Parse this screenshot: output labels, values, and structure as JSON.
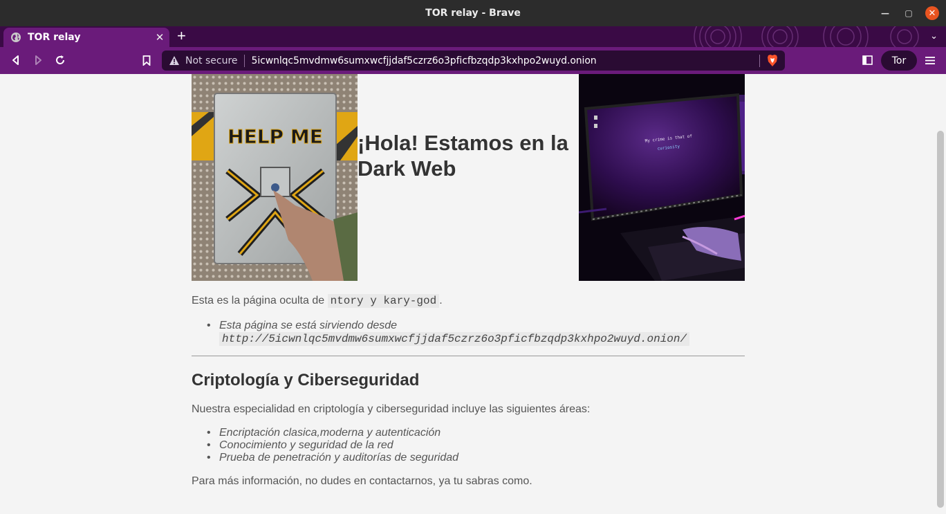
{
  "window": {
    "title": "TOR relay - Brave"
  },
  "tab": {
    "title": "TOR relay"
  },
  "toolbar": {
    "security_label": "Not secure",
    "url": "5icwnlqc5mvdmw6sumxwcfjjdaf5czrz6o3pficfbzqdp3kxhpo2wuyd.onion",
    "tor_label": "Tor"
  },
  "colors": {
    "tab_strip": "#3a0a45",
    "toolbar": "#6a1b7a",
    "urlbar": "#2a0b33",
    "close_button": "#e95420"
  },
  "page": {
    "hero_title": "¡Hola! Estamos en la Dark Web",
    "left_image_text": "HELP ME",
    "right_image_text_line1": "My crime is that of",
    "right_image_text_line2": "curiosity",
    "intro_prefix": "Esta es la página oculta de ",
    "intro_code": "ntory y kary-god",
    "intro_suffix": ".",
    "served_text": "Esta página se está sirviendo desde",
    "served_url": "http://5icwnlqc5mvdmw6sumxwcfjjdaf5czrz6o3pficfbzqdp3kxhpo2wuyd.onion/",
    "section_title": "Criptología y Ciberseguridad",
    "section_desc": "Nuestra especialidad en criptología y ciberseguridad incluye las siguientes áreas:",
    "areas": [
      "Encriptación clasica,moderna y autenticación",
      "Conocimiento y seguridad de la red",
      "Prueba de penetración y auditorías de seguridad"
    ],
    "closing": "Para más información, no dudes en contactarnos, ya tu sabras como."
  }
}
